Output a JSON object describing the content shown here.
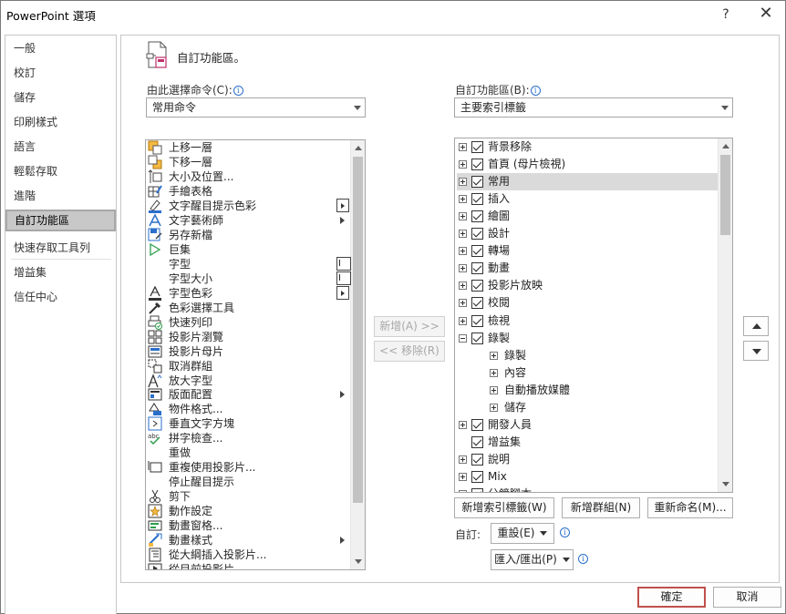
{
  "window": {
    "title": "PowerPoint 選項",
    "help_label": "?",
    "close_label": "✕"
  },
  "nav": {
    "items": [
      {
        "label": "一般"
      },
      {
        "label": "校訂"
      },
      {
        "label": "儲存"
      },
      {
        "label": "印刷樣式"
      },
      {
        "label": "語言"
      },
      {
        "label": "輕鬆存取"
      },
      {
        "label": "進階"
      },
      {
        "label": "自訂功能區",
        "active": true
      },
      {
        "label": "快速存取工具列"
      },
      {
        "label": "增益集"
      },
      {
        "label": "信任中心"
      }
    ]
  },
  "header": {
    "title": "自訂功能區。"
  },
  "left": {
    "label": "由此選擇命令(C):",
    "info": "i",
    "combo_value": "常用命令",
    "commands": [
      {
        "label": "上移一層",
        "icon": "bring-forward-icon"
      },
      {
        "label": "下移一層",
        "icon": "send-backward-icon"
      },
      {
        "label": "大小及位置...",
        "icon": "size-position-icon"
      },
      {
        "label": "手繪表格",
        "icon": "draw-table-icon"
      },
      {
        "label": "文字醒目提示色彩",
        "icon": "text-highlight-icon",
        "sub": "split"
      },
      {
        "label": "文字藝術師",
        "icon": "wordart-icon",
        "sub": "arrow"
      },
      {
        "label": "另存新檔",
        "icon": "save-as-icon"
      },
      {
        "label": "巨集",
        "icon": "macro-play-icon"
      },
      {
        "label": "字型",
        "icon": "",
        "sub": "drop",
        "drop_glyph": "I"
      },
      {
        "label": "字型大小",
        "icon": "",
        "sub": "drop",
        "drop_glyph": "I"
      },
      {
        "label": "字型色彩",
        "icon": "font-color-icon",
        "sub": "split"
      },
      {
        "label": "色彩選擇工具",
        "icon": "eyedropper-icon"
      },
      {
        "label": "快速列印",
        "icon": "quick-print-icon"
      },
      {
        "label": "投影片瀏覽",
        "icon": "slide-sorter-icon"
      },
      {
        "label": "投影片母片",
        "icon": "slide-master-icon"
      },
      {
        "label": "取消群組",
        "icon": "ungroup-icon"
      },
      {
        "label": "放大字型",
        "icon": "grow-font-icon"
      },
      {
        "label": "版面配置",
        "icon": "layout-icon",
        "sub": "arrow"
      },
      {
        "label": "物件格式...",
        "icon": "format-object-icon"
      },
      {
        "label": "垂直文字方塊",
        "icon": "vertical-textbox-icon"
      },
      {
        "label": "拼字檢查...",
        "icon": "spelling-icon"
      },
      {
        "label": "重做",
        "icon": ""
      },
      {
        "label": "重複使用投影片...",
        "icon": "reuse-slides-icon"
      },
      {
        "label": "停止醒目提示",
        "icon": ""
      },
      {
        "label": "剪下",
        "icon": "scissors-icon"
      },
      {
        "label": "動作設定",
        "icon": "action-icon"
      },
      {
        "label": "動畫窗格...",
        "icon": "animation-pane-icon"
      },
      {
        "label": "動畫樣式",
        "icon": "animation-styles-icon",
        "sub": "arrow"
      },
      {
        "label": "從大綱插入投影片...",
        "icon": "outline-icon"
      },
      {
        "label": "從目前投影片",
        "icon": "from-current-icon"
      }
    ]
  },
  "middle": {
    "add_label": "新增(A) >>",
    "remove_label": "<< 移除(R)"
  },
  "right": {
    "label": "自訂功能區(B):",
    "info": "i",
    "combo_value": "主要索引標籤",
    "tabs": [
      {
        "label": "背景移除",
        "level": 0,
        "expander": "plus",
        "checked": true
      },
      {
        "label": "首頁 (母片檢視)",
        "level": 0,
        "expander": "plus",
        "checked": true
      },
      {
        "label": "常用",
        "level": 0,
        "expander": "plus",
        "checked": true,
        "selected": true
      },
      {
        "label": "插入",
        "level": 0,
        "expander": "plus",
        "checked": true
      },
      {
        "label": "繪圖",
        "level": 0,
        "expander": "plus",
        "checked": true
      },
      {
        "label": "設計",
        "level": 0,
        "expander": "plus",
        "checked": true
      },
      {
        "label": "轉場",
        "level": 0,
        "expander": "plus",
        "checked": true
      },
      {
        "label": "動畫",
        "level": 0,
        "expander": "plus",
        "checked": true
      },
      {
        "label": "投影片放映",
        "level": 0,
        "expander": "plus",
        "checked": true
      },
      {
        "label": "校閱",
        "level": 0,
        "expander": "plus",
        "checked": true
      },
      {
        "label": "檢視",
        "level": 0,
        "expander": "plus",
        "checked": true
      },
      {
        "label": "錄製",
        "level": 0,
        "expander": "minus",
        "checked": true
      },
      {
        "label": "錄製",
        "level": 1,
        "expander": "plus",
        "checked": null
      },
      {
        "label": "內容",
        "level": 1,
        "expander": "plus",
        "checked": null
      },
      {
        "label": "自動播放媒體",
        "level": 1,
        "expander": "plus",
        "checked": null
      },
      {
        "label": "儲存",
        "level": 1,
        "expander": "plus",
        "checked": null
      },
      {
        "label": "開發人員",
        "level": 0,
        "expander": "plus",
        "checked": true
      },
      {
        "label": "增益集",
        "level": 0,
        "expander": "none",
        "checked": true
      },
      {
        "label": "說明",
        "level": 0,
        "expander": "plus",
        "checked": true
      },
      {
        "label": "Mix",
        "level": 0,
        "expander": "plus",
        "checked": true
      },
      {
        "label": "分鏡腳本",
        "level": 0,
        "expander": "plus",
        "checked": true
      }
    ],
    "new_tab_label": "新增索引標籤(W)",
    "new_group_label": "新增群組(N)",
    "rename_label": "重新命名(M)...",
    "customize_label": "自訂:",
    "reset_label": "重設(E)",
    "import_export_label": "匯入/匯出(P)"
  },
  "footer": {
    "ok_label": "確定",
    "cancel_label": "取消"
  }
}
